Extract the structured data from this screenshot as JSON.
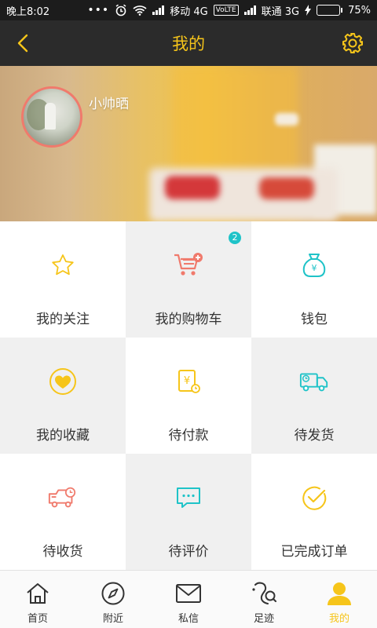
{
  "status_bar": {
    "time": "晚上8:02",
    "carrier1": "移动 4G",
    "volte": "VoLTE",
    "carrier2": "联通 3G",
    "battery": "75%",
    "battery_level": 0.75
  },
  "header": {
    "title": "我的"
  },
  "profile": {
    "username": "小帅晒"
  },
  "grid": [
    {
      "label": "我的关注",
      "icon": "star-icon"
    },
    {
      "label": "我的购物车",
      "icon": "shopping-cart-icon",
      "badge": "2"
    },
    {
      "label": "钱包",
      "icon": "money-bag-icon"
    },
    {
      "label": "我的收藏",
      "icon": "heart-icon"
    },
    {
      "label": "待付款",
      "icon": "payment-pending-icon"
    },
    {
      "label": "待发货",
      "icon": "delivery-truck-icon"
    },
    {
      "label": "待收货",
      "icon": "receive-truck-icon"
    },
    {
      "label": "待评价",
      "icon": "comment-icon"
    },
    {
      "label": "已完成订单",
      "icon": "check-circle-icon"
    }
  ],
  "nav": [
    {
      "label": "首页",
      "icon": "home-icon"
    },
    {
      "label": "附近",
      "icon": "compass-icon"
    },
    {
      "label": "私信",
      "icon": "mail-icon"
    },
    {
      "label": "足迹",
      "icon": "footprint-icon"
    },
    {
      "label": "我的",
      "icon": "user-icon"
    }
  ],
  "colors": {
    "accent": "#f6c51a",
    "header_bg": "#2b2b2b",
    "cart_red": "#f07a6c",
    "teal": "#1fc3c8"
  }
}
